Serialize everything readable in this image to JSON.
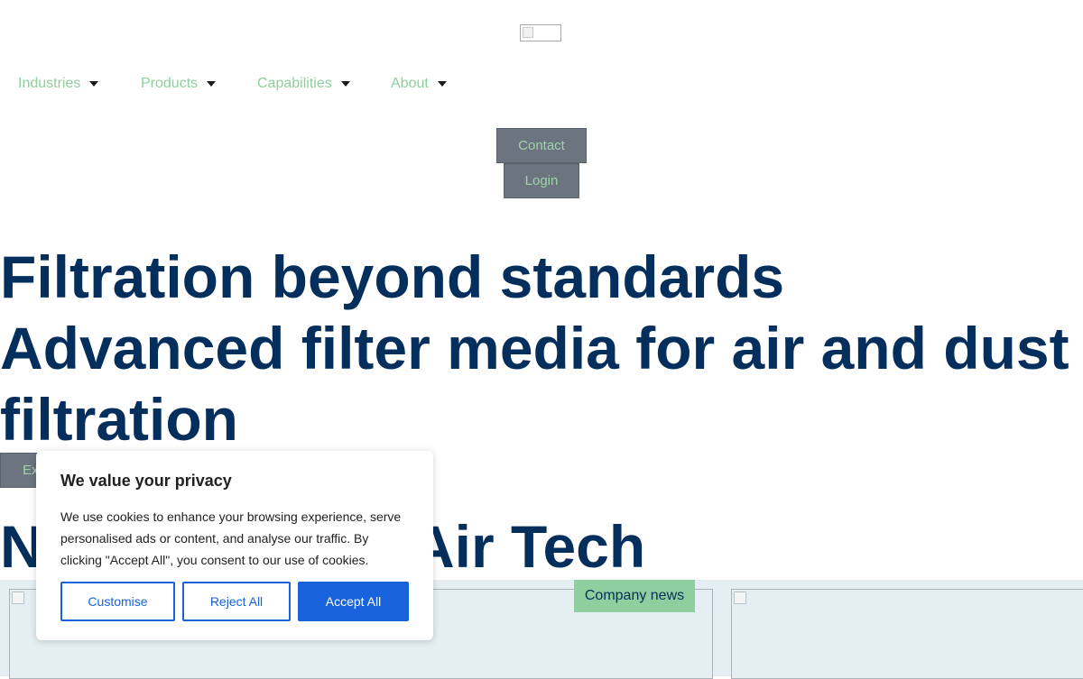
{
  "nav": {
    "items": [
      {
        "label": "Industries"
      },
      {
        "label": "Products"
      },
      {
        "label": "Capabilities"
      },
      {
        "label": "About"
      }
    ]
  },
  "header": {
    "contact_label": "Contact",
    "login_label": "Login"
  },
  "hero": {
    "title": "Filtration beyond standards",
    "subtitle": "Advanced filter media for air and dust filtration",
    "cta_label": "Ex"
  },
  "news": {
    "section_title_left": "N",
    "section_title_right": "Air Tech",
    "badge": "Company news"
  },
  "cookie": {
    "title": "We value your privacy",
    "body": "We use cookies to enhance your browsing experience, serve personalised ads or content, and analyse our traffic. By clicking \"Accept All\", you consent to our use of cookies.",
    "customise_label": "Customise",
    "reject_label": "Reject All",
    "accept_label": "Accept All"
  },
  "colors": {
    "accent_green": "#8fce9e",
    "heading_navy": "#042e5c",
    "cookie_blue": "#1863dc",
    "button_gray": "#6c7480"
  }
}
